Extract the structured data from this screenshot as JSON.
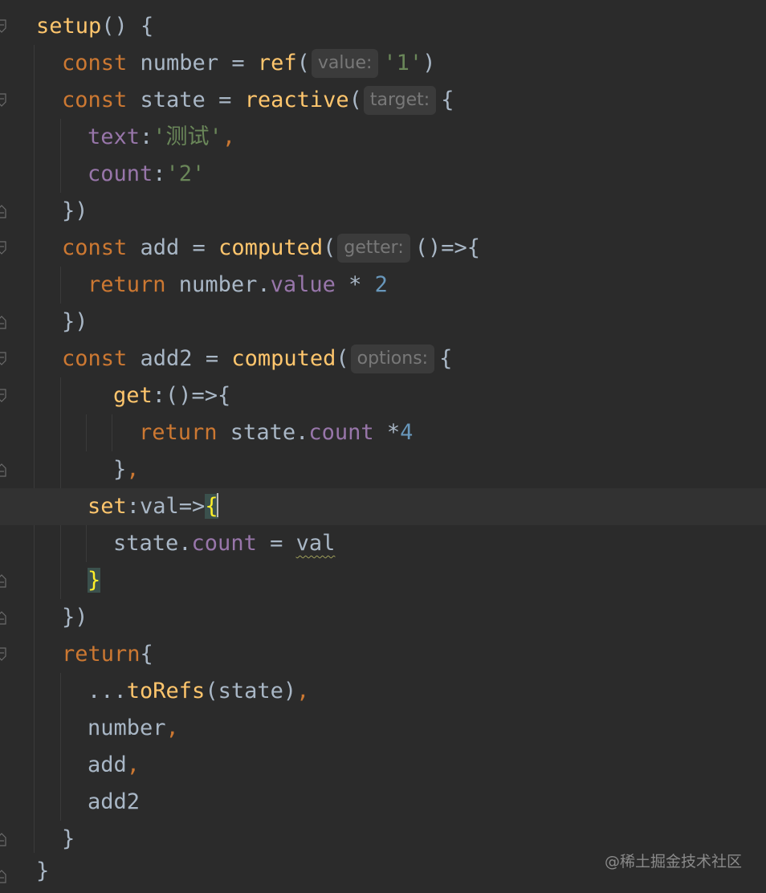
{
  "editor": {
    "lines": {
      "setup_name": "setup",
      "setup_paren": "() {",
      "const1": "const",
      "number_decl": " number = ",
      "ref_fn": "ref",
      "ref_open": "(",
      "hint_value": "value:",
      "str_1": "'1'",
      "ref_close": ")",
      "const2": "const",
      "state_decl": " state = ",
      "reactive_fn": "reactive",
      "reactive_open": "(",
      "hint_target": "target:",
      "open_brace1": "{",
      "text_key": "text",
      "colon1": ":",
      "text_val": "'测试'",
      "comma1": ",",
      "count_key": "count",
      "colon2": ":",
      "count_val": "'2'",
      "close1": "})",
      "const3": "const",
      "add_decl": " add = ",
      "computed_fn1": "computed",
      "computed_open1": "(",
      "hint_getter": "getter:",
      "arrow1": "()=>{",
      "return1": "return",
      "number_ref": " number.",
      "value_prop": "value",
      "times2": " * ",
      "num2": "2",
      "close2": "})",
      "const4": "const",
      "add2_decl": " add2 = ",
      "computed_fn2": "computed",
      "computed_open2": "(",
      "hint_options": "options:",
      "open_brace2": "{",
      "get_key": "get",
      "get_arrow": ":()=>{",
      "return2": "return",
      "state_ref1": " state.",
      "count_prop1": "count",
      "times4": " *",
      "num4": "4",
      "get_close": "}",
      "get_comma": ",",
      "set_key": "set",
      "set_colon": ":val=>",
      "set_brace_open": "{",
      "state_ref2": "state.",
      "count_prop2": "count",
      "assign": " = ",
      "val_ref": "val",
      "set_brace_close": "}",
      "close3": "})",
      "return3": "return",
      "return_brace": "{",
      "spread": "...",
      "torefs_fn": "toRefs",
      "torefs_args": "(state)",
      "comma2": ",",
      "ret_number": "number",
      "comma3": ",",
      "ret_add": "add",
      "comma4": ",",
      "ret_add2": "add2",
      "return_close": "}",
      "setup_close": "}"
    },
    "colors": {
      "background": "#2b2b2b",
      "current_line": "#323232",
      "keyword": "#cc7832",
      "function": "#ffc66d",
      "property": "#9876aa",
      "string": "#6a8759",
      "number": "#6897bb",
      "identifier": "#a9b7c6",
      "hint_text": "#787878",
      "hint_bg": "#3b3b3b"
    }
  },
  "watermark": "@稀土掘金技术社区"
}
